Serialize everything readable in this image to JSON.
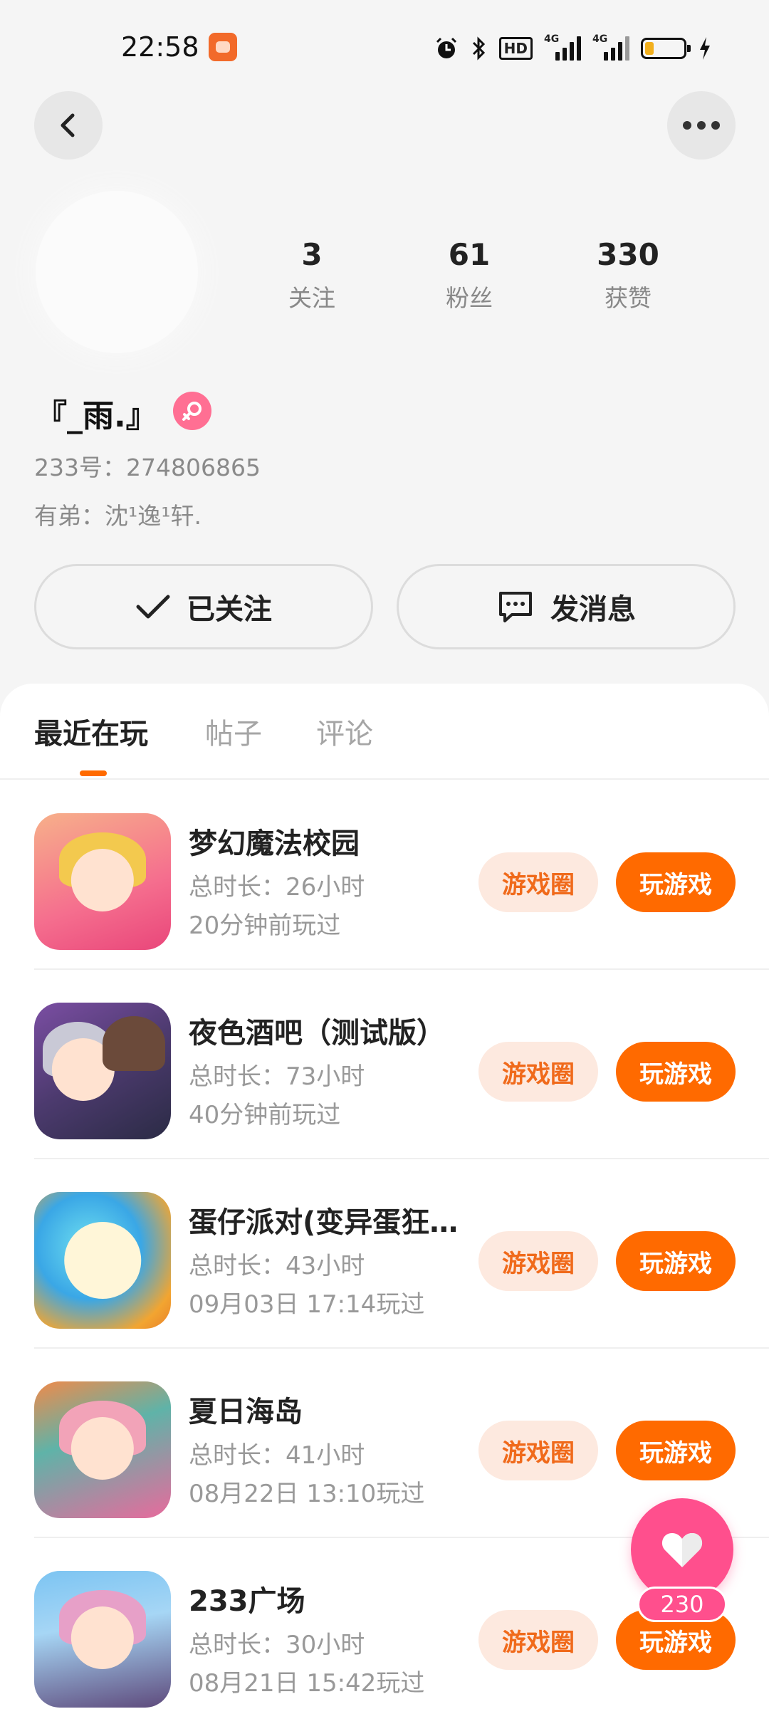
{
  "status_bar": {
    "time": "22:58",
    "hd_label": "HD",
    "signal_label_1": "4G",
    "signal_label_2": "4G"
  },
  "profile": {
    "stats": [
      {
        "value": "3",
        "label": "关注"
      },
      {
        "value": "61",
        "label": "粉丝"
      },
      {
        "value": "330",
        "label": "获赞"
      }
    ],
    "nickname": "『_雨.』",
    "uid": "233号：274806865",
    "bio": "有弟：沈¹逸¹轩.",
    "gender": "female"
  },
  "actions": {
    "followed_label": "已关注",
    "message_label": "发消息"
  },
  "tabs": [
    {
      "label": "最近在玩",
      "active": true
    },
    {
      "label": "帖子",
      "active": false
    },
    {
      "label": "评论",
      "active": false
    }
  ],
  "games": [
    {
      "name": "梦幻魔法校园",
      "duration": "总时长：26小时",
      "last_played": "20分钟前玩过"
    },
    {
      "name": "夜色酒吧（测试版）",
      "duration": "总时长：73小时",
      "last_played": "40分钟前玩过"
    },
    {
      "name": "蛋仔派对(变异蛋狂欢)",
      "duration": "总时长：43小时",
      "last_played": "09月03日 17:14玩过"
    },
    {
      "name": "夏日海岛",
      "duration": "总时长：41小时",
      "last_played": "08月22日 13:10玩过"
    },
    {
      "name": "233广场",
      "duration": "总时长：30小时",
      "last_played": "08月21日 15:42玩过"
    }
  ],
  "game_buttons": {
    "circle_label": "游戏圈",
    "play_label": "玩游戏"
  },
  "like": {
    "count": "230"
  },
  "colors": {
    "accent": "#ff6a00",
    "accent_light": "#fde9df",
    "like_pink": "#ff4f8d",
    "gender_pink": "#ff6f93"
  },
  "icons": [
    "back-arrow-icon",
    "more-dots-icon",
    "check-icon",
    "chat-bubble-icon",
    "female-icon",
    "heart-icon",
    "alarm-icon",
    "bluetooth-icon",
    "battery-icon",
    "charging-icon"
  ]
}
